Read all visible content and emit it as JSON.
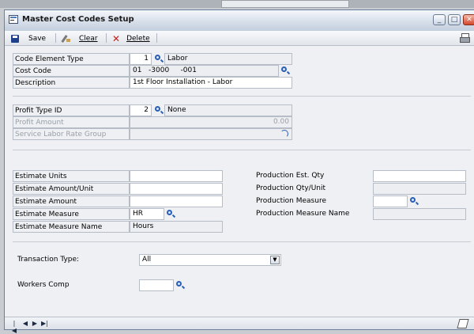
{
  "window": {
    "title": "Master Cost Codes Setup"
  },
  "toolbar": {
    "save": "Save",
    "clear": "Clear",
    "delete": "Delete"
  },
  "code_section": {
    "code_element_type_label": "Code Element Type",
    "code_element_type_value": "1",
    "code_element_type_desc": "Labor",
    "cost_code_label": "Cost Code",
    "cost_code_value": "01   -3000     -001",
    "description_label": "Description",
    "description_value": "1st Floor Installation - Labor"
  },
  "profit_section": {
    "profit_type_label": "Profit Type ID",
    "profit_type_value": "2",
    "profit_type_desc": "None",
    "profit_amount_label": "Profit Amount",
    "profit_amount_value": "0.00",
    "service_labor_label": "Service Labor Rate Group"
  },
  "estimate_section": {
    "units_label": "Estimate Units",
    "amount_unit_label": "Estimate Amount/Unit",
    "amount_label": "Estimate Amount",
    "measure_label": "Estimate Measure",
    "measure_value": "HR",
    "measure_name_label": "Estimate Measure Name",
    "measure_name_value": "Hours"
  },
  "production_section": {
    "est_qty_label": "Production Est. Qty",
    "qty_unit_label": "Production Qty/Unit",
    "measure_label": "Production Measure",
    "measure_name_label": "Production Measure Name"
  },
  "transaction": {
    "label": "Transaction Type:",
    "value": "All"
  },
  "workers_comp": {
    "label": "Workers Comp"
  },
  "colors": {
    "accent": "#2b5fb3",
    "delete": "#c0201a",
    "close_button": "#d2472b"
  }
}
